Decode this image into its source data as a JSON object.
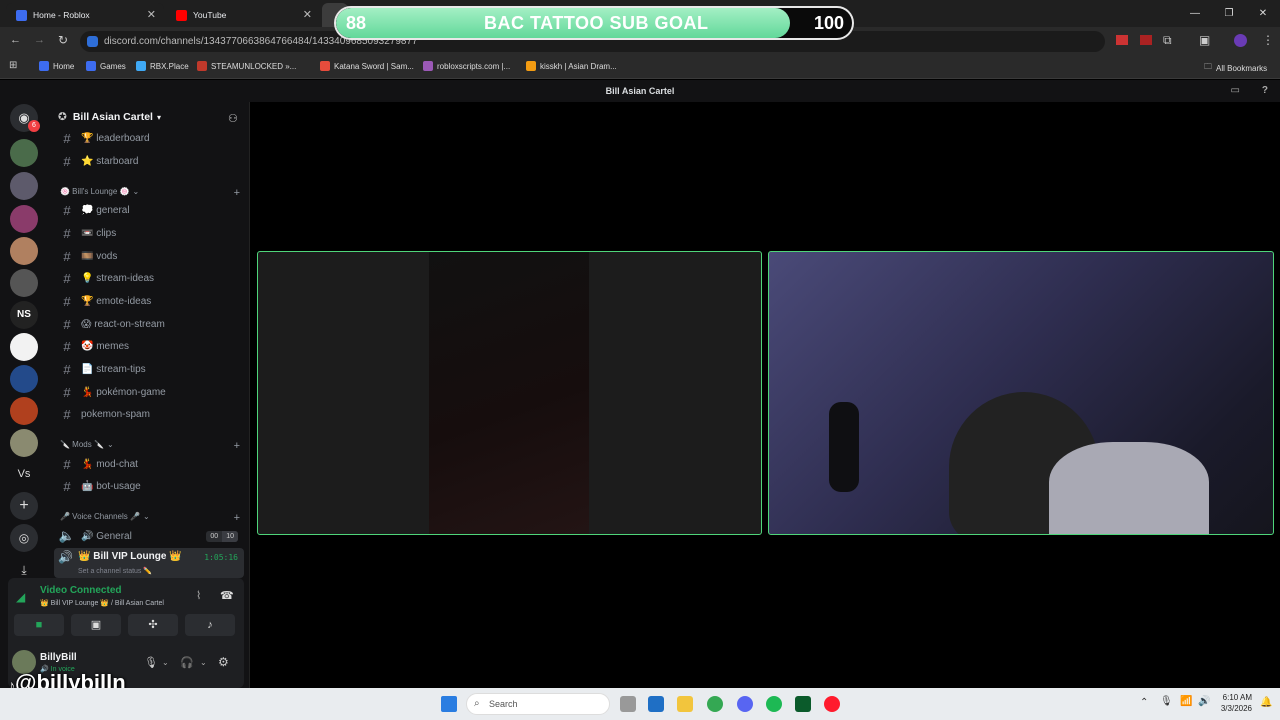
{
  "browser": {
    "tabs": [
      {
        "title": "Home - Roblox",
        "favicon_color": "#3d6cf0"
      },
      {
        "title": "YouTube",
        "favicon_color": "#ff0000"
      }
    ],
    "url": "discord.com/channels/1343770663864766484/1433409685093279877",
    "bookmarks": [
      {
        "label": "Home",
        "color": "#3d6cf0"
      },
      {
        "label": "Games",
        "color": "#3d6cf0"
      },
      {
        "label": "RBX.Place",
        "color": "#3fa9f5"
      },
      {
        "label": "STEAMUNLOCKED »...",
        "color": "#c0392b"
      },
      {
        "label": "Katana Sword | Sam...",
        "color": "#e74c3c"
      },
      {
        "label": "robloxscripts.com |...",
        "color": "#9b59b6"
      },
      {
        "label": "kisskh | Asian Dram...",
        "color": "#f39c12"
      }
    ],
    "all_bookmarks": "All Bookmarks"
  },
  "goal": {
    "start": "88",
    "title": "BAC TATTOO SUB GOAL",
    "end": "100",
    "progress": 0.88
  },
  "discord": {
    "window_title": "Bill Asian Cartel",
    "server_name": "Bill Asian Cartel",
    "notification_badge": "6",
    "channels_top": [
      {
        "label": "🏆 leaderboard"
      },
      {
        "label": "⭐ starboard"
      }
    ],
    "category_lounge": "🍥 Bill's Lounge 🍥",
    "lounge_channels": [
      {
        "label": "💭 general"
      },
      {
        "label": "📼 clips"
      },
      {
        "label": "🎞️ vods"
      },
      {
        "label": "💡 stream-ideas"
      },
      {
        "label": "🏆 emote-ideas"
      },
      {
        "label": "😱 react-on-stream"
      },
      {
        "label": "🤡 memes"
      },
      {
        "label": "📄 stream-tips"
      },
      {
        "label": "💃 pokémon-game"
      },
      {
        "label": "pokemon-spam"
      }
    ],
    "category_mods": "🔪 Mods 🔪",
    "mod_channels": [
      {
        "label": "💃 mod-chat"
      },
      {
        "label": "🤖 bot-usage"
      }
    ],
    "category_voice": "🎤 Voice Channels 🎤",
    "voice_general": "🔊 General",
    "voice_general_counts": [
      "00",
      "10"
    ],
    "vip_lounge": "👑 Bill VIP Lounge 👑",
    "vip_timer": "1:05:16",
    "vip_status": "Set a channel status ✏️",
    "video_connected": "Video Connected",
    "connected_location": "👑 Bill VIP Lounge 👑 / Bill Asian Cartel",
    "username": "BillyBill",
    "user_status": "🔊 In voice",
    "overlay_handle": "@billybilln"
  },
  "taskbar": {
    "search_placeholder": "Search",
    "time": "6:10 AM",
    "date": "3/3/2026"
  }
}
